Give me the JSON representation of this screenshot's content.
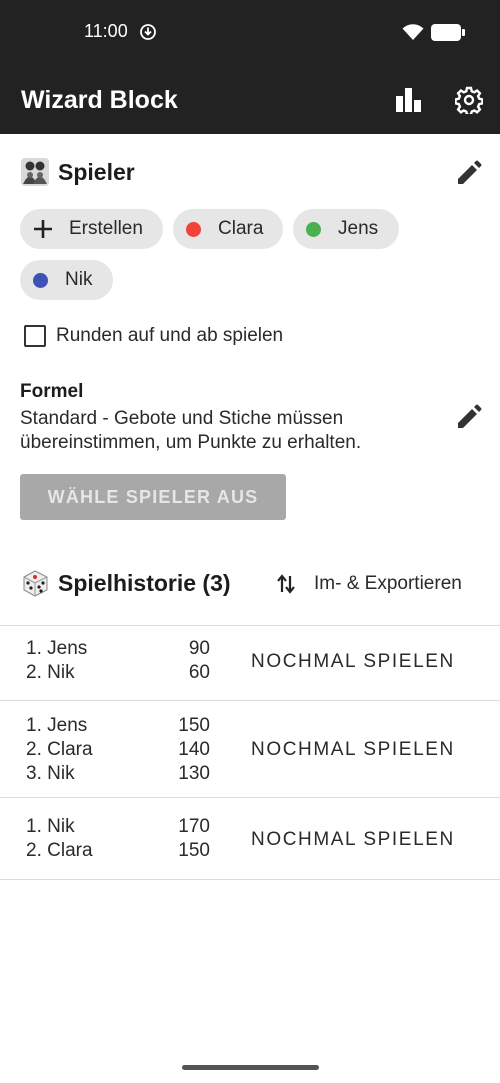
{
  "status_bar": {
    "time": "11:00"
  },
  "app_bar": {
    "title": "Wizard Block",
    "stats_icon": "bar-chart-icon",
    "settings_icon": "gear-icon"
  },
  "players": {
    "title": "Spieler",
    "emoji_icon": "family-emoji-icon",
    "create_label": "Erstellen",
    "chips": [
      {
        "name": "Clara",
        "color": "#f04438"
      },
      {
        "name": "Jens",
        "color": "#4caf50"
      },
      {
        "name": "Nik",
        "color": "#3f51b5"
      }
    ],
    "checkbox_label": "Runden auf und ab spielen",
    "checkbox_checked": false
  },
  "formula": {
    "title": "Formel",
    "description": "Standard - Gebote und Stiche müssen übereinstimmen, um Punkte zu erhalten."
  },
  "select_button": "WÄHLE SPIELER AUS",
  "history": {
    "title": "Spielhistorie (3)",
    "emoji_icon": "dice-emoji-icon",
    "export_label": "Im- & Exportieren",
    "replay_label": "NOCHMAL SPIELEN",
    "games": [
      {
        "ranking": [
          {
            "place": "1. Jens",
            "score": "90"
          },
          {
            "place": "2. Nik",
            "score": "60"
          }
        ]
      },
      {
        "ranking": [
          {
            "place": "1. Jens",
            "score": "150"
          },
          {
            "place": "2. Clara",
            "score": "140"
          },
          {
            "place": "3. Nik",
            "score": "130"
          }
        ]
      },
      {
        "ranking": [
          {
            "place": "1. Nik",
            "score": "170"
          },
          {
            "place": "2. Clara",
            "score": "150"
          }
        ]
      }
    ]
  }
}
